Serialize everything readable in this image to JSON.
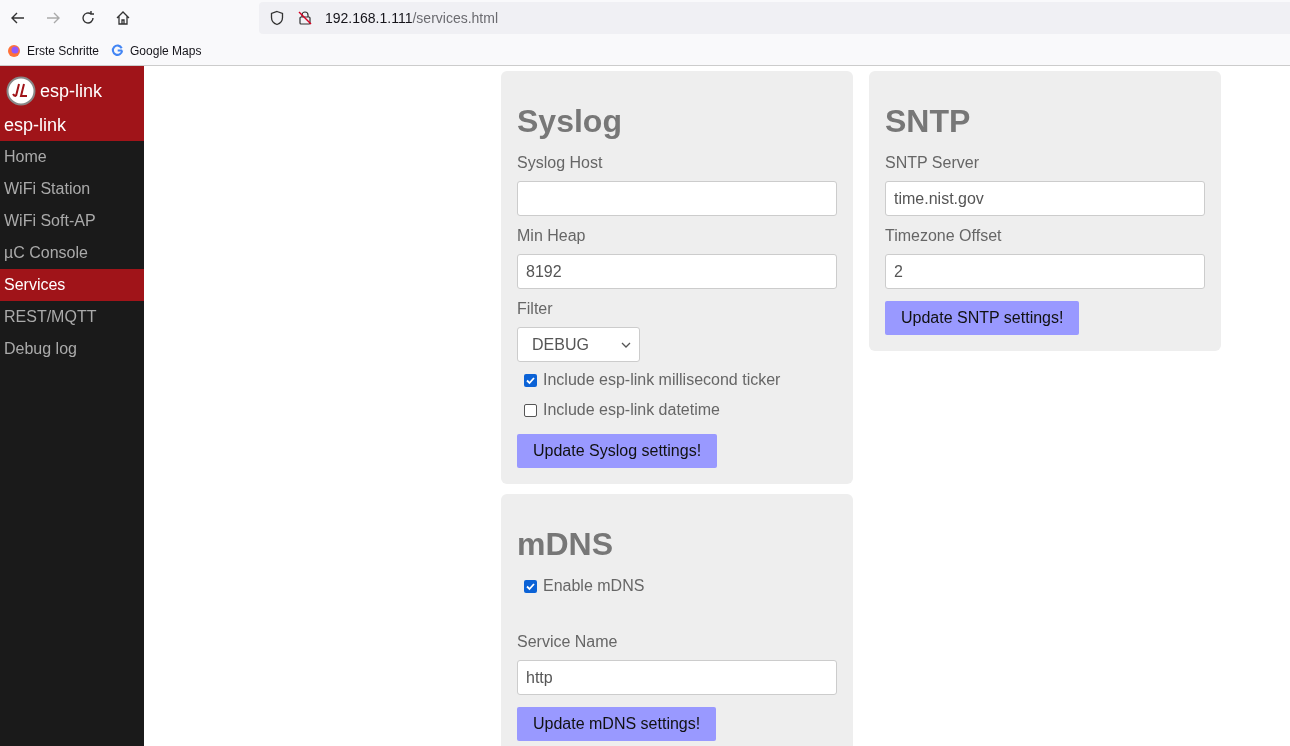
{
  "browser": {
    "url_host": "192.168.1.111",
    "url_path": "/services.html",
    "bookmarks": [
      {
        "label": "Erste Schritte",
        "kind": "firefox"
      },
      {
        "label": "Google Maps",
        "kind": "google"
      }
    ]
  },
  "sidebar": {
    "brand": "esp-link",
    "subtitle": "esp-link",
    "items": [
      {
        "label": "Home",
        "selected": false
      },
      {
        "label": "WiFi Station",
        "selected": false
      },
      {
        "label": "WiFi Soft-AP",
        "selected": false
      },
      {
        "label": "µC Console",
        "selected": false
      },
      {
        "label": "Services",
        "selected": true
      },
      {
        "label": "REST/MQTT",
        "selected": false
      },
      {
        "label": "Debug log",
        "selected": false
      }
    ]
  },
  "columns": [
    [
      {
        "title": "Syslog",
        "fields": [
          {
            "kind": "text",
            "label": "Syslog Host"
          },
          {
            "kind": "text",
            "label": "Min Heap",
            "value": "8192"
          },
          {
            "kind": "select",
            "label": "Filter",
            "value": "DEBUG"
          },
          {
            "kind": "checkbox",
            "label": "Include esp-link millisecond ticker",
            "checked": true
          },
          {
            "kind": "checkbox",
            "label": "Include esp-link datetime",
            "checked": false
          }
        ],
        "button": "Update Syslog settings!"
      },
      {
        "title": "mDNS",
        "fields": [
          {
            "kind": "checkbox",
            "label": "Enable mDNS",
            "checked": true
          },
          {
            "kind": "text",
            "label": "Service Name",
            "value": "http"
          }
        ],
        "button": "Update mDNS settings!"
      }
    ],
    [
      {
        "title": "SNTP",
        "fields": [
          {
            "kind": "text",
            "label": "SNTP Server",
            "value": "time.nist.gov"
          },
          {
            "kind": "text",
            "label": "Timezone Offset",
            "value": "2"
          }
        ],
        "button": "Update SNTP settings!"
      }
    ]
  ]
}
